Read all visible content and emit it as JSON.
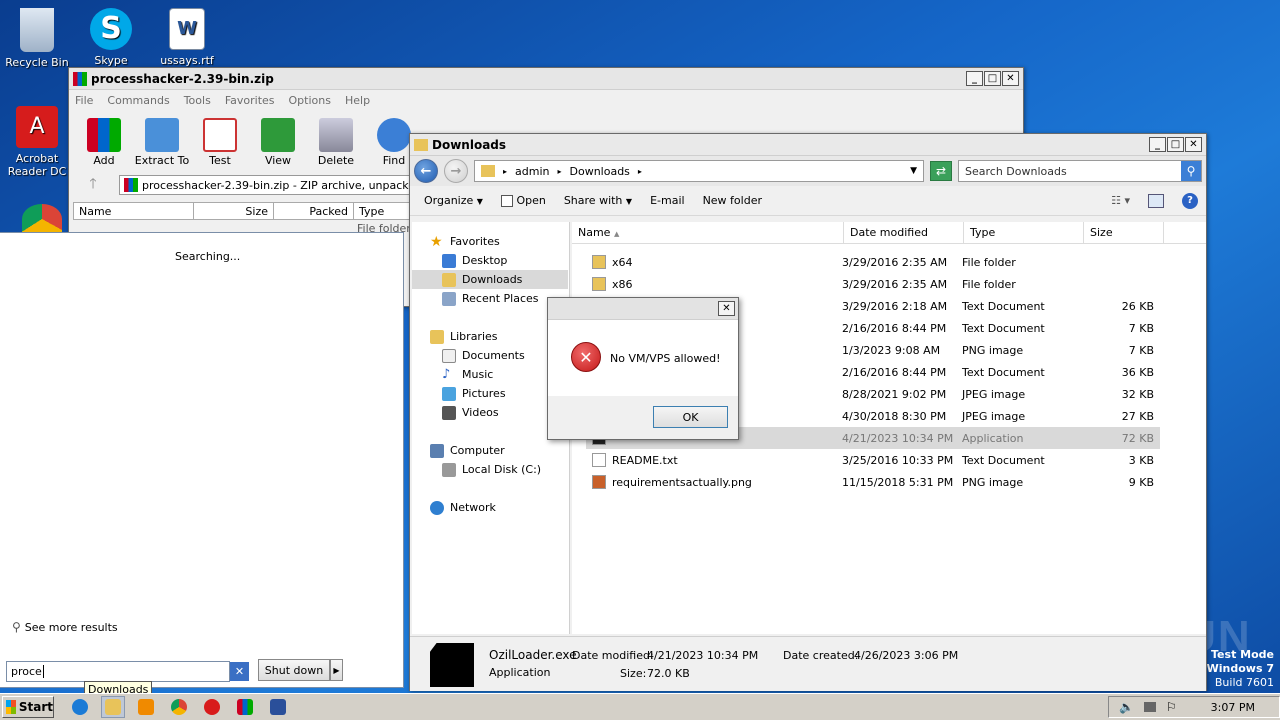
{
  "desktop": {
    "icons": [
      {
        "label": "Recycle Bin",
        "icon": "recycle-bin-icon"
      },
      {
        "label": "Skype",
        "icon": "skype-icon"
      },
      {
        "label": "ussays.rtf",
        "icon": "word-document-icon"
      },
      {
        "label": "Acrobat Reader DC",
        "icon": "acrobat-icon"
      }
    ],
    "watermark": "ANY RUN",
    "os_badge": {
      "line1": "Test Mode",
      "line2": "Windows 7",
      "line3": "Build 7601"
    }
  },
  "winrar": {
    "title": "processhacker-2.39-bin.zip",
    "menu": [
      "File",
      "Commands",
      "Tools",
      "Favorites",
      "Options",
      "Help"
    ],
    "tools": [
      "Add",
      "Extract To",
      "Test",
      "View",
      "Delete",
      "Find"
    ],
    "address": "processhacker-2.39-bin.zip - ZIP archive, unpacked siz",
    "columns": [
      "Name",
      "Size",
      "Packed",
      "Type"
    ],
    "first_row_type": "File folder"
  },
  "startmenu": {
    "status": "Searching...",
    "see_more": "See more results",
    "search_value": "proce",
    "shutdown": "Shut down",
    "tooltip": "Downloads"
  },
  "explorer": {
    "title": "Downloads",
    "breadcrumb": [
      "admin",
      "Downloads"
    ],
    "search_placeholder": "Search Downloads",
    "commands": [
      "Organize",
      "Open",
      "Share with",
      "E-mail",
      "New folder"
    ],
    "nav": {
      "favorites": "Favorites",
      "favorites_items": [
        "Desktop",
        "Downloads",
        "Recent Places"
      ],
      "libraries": "Libraries",
      "libraries_items": [
        "Documents",
        "Music",
        "Pictures",
        "Videos"
      ],
      "computer": "Computer",
      "computer_items": [
        "Local Disk (C:)"
      ],
      "network": "Network"
    },
    "columns": [
      "Name",
      "Date modified",
      "Type",
      "Size"
    ],
    "files": [
      {
        "name": "x64",
        "date": "3/29/2016 2:35 AM",
        "type": "File folder",
        "size": ""
      },
      {
        "name": "x86",
        "date": "3/29/2016 2:35 AM",
        "type": "File folder",
        "size": ""
      },
      {
        "name": "",
        "date": "3/29/2016 2:18 AM",
        "type": "Text Document",
        "size": "26 KB"
      },
      {
        "name": "",
        "date": "2/16/2016 8:44 PM",
        "type": "Text Document",
        "size": "7 KB"
      },
      {
        "name": "",
        "date": "1/3/2023 9:08 AM",
        "type": "PNG image",
        "size": "7 KB"
      },
      {
        "name": "",
        "date": "2/16/2016 8:44 PM",
        "type": "Text Document",
        "size": "36 KB"
      },
      {
        "name": "",
        "date": "8/28/2021 9:02 PM",
        "type": "JPEG image",
        "size": "32 KB"
      },
      {
        "name": "",
        "date": "4/30/2018 8:30 PM",
        "type": "JPEG image",
        "size": "27 KB"
      },
      {
        "name": "",
        "date": "4/21/2023 10:34 PM",
        "type": "Application",
        "size": "72 KB"
      },
      {
        "name": "README.txt",
        "date": "3/25/2016 10:33 PM",
        "type": "Text Document",
        "size": "3 KB"
      },
      {
        "name": "requirementsactually.png",
        "date": "11/15/2018 5:31 PM",
        "type": "PNG image",
        "size": "9 KB"
      }
    ],
    "details": {
      "filename": "OzilLoader.exe",
      "type": "Application",
      "modified_label": "Date modified:",
      "modified": "4/21/2023 10:34 PM",
      "created_label": "Date created:",
      "created": "4/26/2023 3:06 PM",
      "size_label": "Size:",
      "size": "72.0 KB"
    }
  },
  "dialog": {
    "message": "No VM/VPS allowed!",
    "ok": "OK",
    "close": "✕"
  },
  "taskbar": {
    "start": "Start",
    "clock": "3:07 PM",
    "apps": [
      "ie-icon",
      "explorer-icon",
      "media-player-icon",
      "chrome-icon",
      "opera-icon",
      "winrar-icon",
      "powershell-icon"
    ]
  }
}
